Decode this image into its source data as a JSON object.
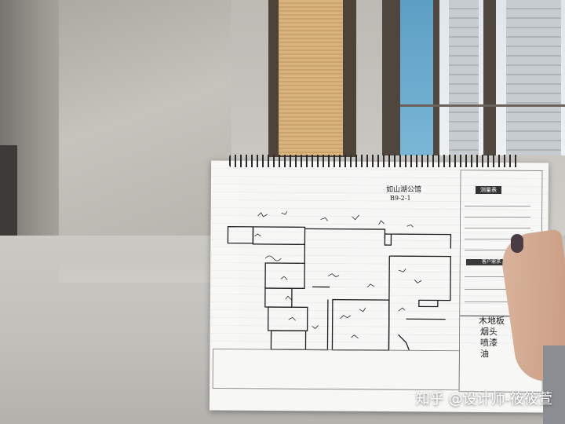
{
  "scene": {
    "description_label": ""
  },
  "panel": {
    "title": "测量表",
    "section_title": "客户需求"
  },
  "handwritten_notes": {
    "header_line1": "如山湖公馆",
    "header_line2": "B9-2-1",
    "remark_1": "木地板",
    "remark_2": "烟头",
    "remark_3": "喷漆",
    "remark_4": "油"
  },
  "watermark": {
    "text": "知乎 @设计师-筱筱萱"
  },
  "colors": {
    "paper": "#f7f7f5",
    "ink": "#1b1b1b",
    "concrete": "#c0beb9"
  }
}
